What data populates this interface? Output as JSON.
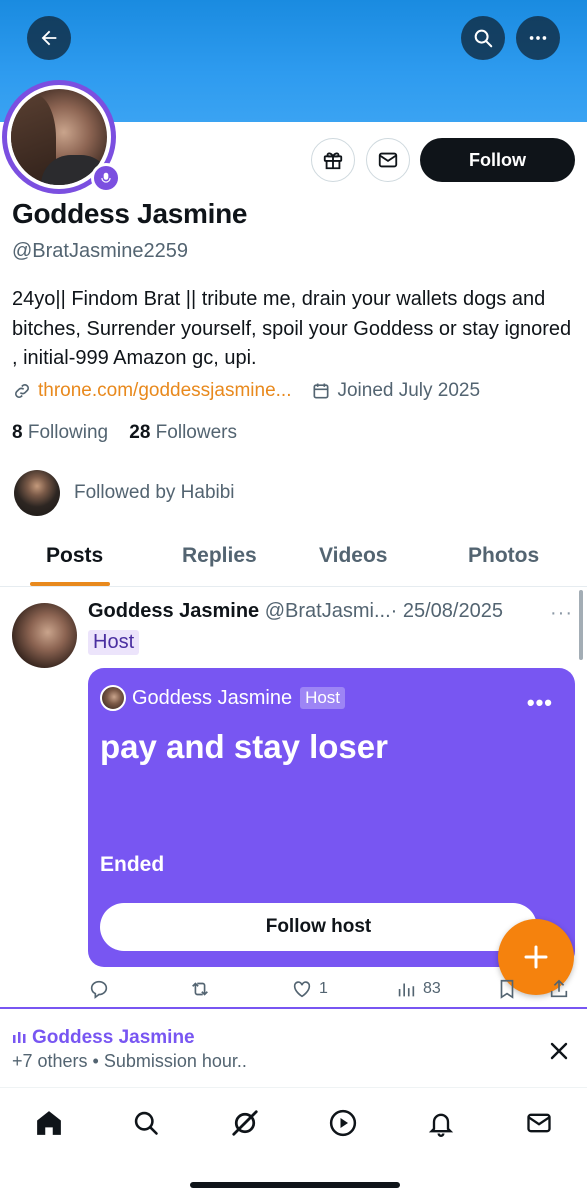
{
  "header": {
    "back_icon": "arrow-left-icon",
    "search_icon": "search-icon",
    "more_icon": "more-horizontal-icon",
    "banner_color": "#2e9bef"
  },
  "profile": {
    "name": "Goddess Jasmine",
    "handle": "@BratJasmine2259",
    "bio": "24yo|| Findom Brat || tribute me, drain your wallets dogs and bitches, Surrender yourself, spoil your Goddess or stay ignored , initial-999 Amazon gc, upi.",
    "link": "throne.com/goddessjasmine...",
    "joined": "Joined July 2025",
    "following_count": "8",
    "following_label": "Following",
    "followers_count": "28",
    "followers_label": "Followers",
    "followed_by": "Followed by Habibi",
    "follow_label": "Follow",
    "accent": "#7b4fe0"
  },
  "tabs": [
    {
      "label": "Posts",
      "active": true
    },
    {
      "label": "Replies",
      "active": false
    },
    {
      "label": "Videos",
      "active": false
    },
    {
      "label": "Photos",
      "active": false
    }
  ],
  "post": {
    "author": "Goddess Jasmine",
    "handle": "@BratJasmi...",
    "separator": "·",
    "date": "25/08/2025",
    "more": "···",
    "host_tag": "Host",
    "space": {
      "host_name": "Goddess Jasmine",
      "host_tag": "Host",
      "more": "•••",
      "title": "pay and stay loser",
      "status": "Ended",
      "follow_label": "Follow host",
      "color": "#7856f2"
    },
    "actions": {
      "likes": "1",
      "views": "83"
    }
  },
  "space_bar": {
    "title": "Goddess Jasmine",
    "subtitle": "+7 others • Submission hour.."
  },
  "fab_color": "#f5820d",
  "nav": [
    "home-icon",
    "search-icon",
    "grok-icon",
    "video-icon",
    "notifications-icon",
    "messages-icon"
  ]
}
